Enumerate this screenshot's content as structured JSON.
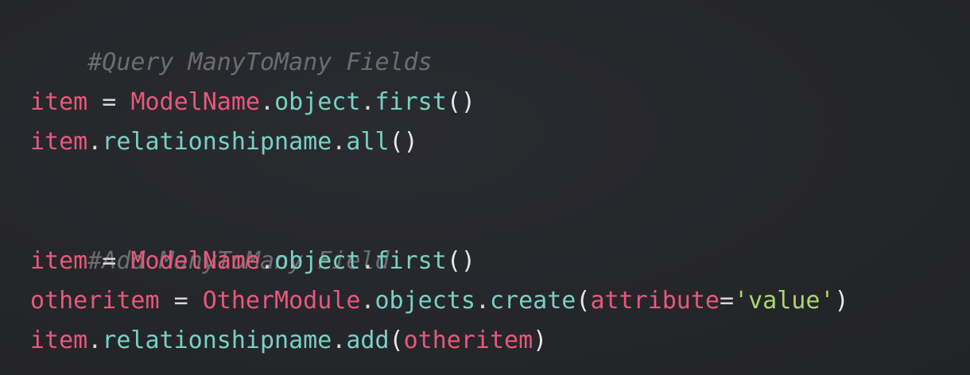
{
  "code": {
    "comment_1": "#Query ManyToMany Fields",
    "l1": {
      "a": "item",
      "eq": " = ",
      "b": "ModelName",
      "d1": ".",
      "c": "object",
      "d2": ".",
      "m": "first",
      "p": "()"
    },
    "l2": {
      "a": "item",
      "d1": ".",
      "b": "relationshipname",
      "d2": ".",
      "m": "all",
      "p": "()"
    },
    "comment_2": "#Add ManyToMany Field",
    "l3": {
      "a": "item",
      "eq": " = ",
      "b": "ModelName",
      "d1": ".",
      "c": "object",
      "d2": ".",
      "m": "first",
      "p": "()"
    },
    "l4": {
      "a": "otheritem",
      "eq": " = ",
      "b": "OtherModule",
      "d1": ".",
      "c": "objects",
      "d2": ".",
      "m": "create",
      "po": "(",
      "arg": "attribute",
      "aeq": "=",
      "val": "'value'",
      "pc": ")"
    },
    "l5": {
      "a": "item",
      "d1": ".",
      "b": "relationshipname",
      "d2": ".",
      "m": "add",
      "po": "(",
      "arg": "otheritem",
      "pc": ")"
    }
  },
  "colors": {
    "background": "#26272b",
    "comment": "#6c6d72",
    "identifier": "#e8587b",
    "method": "#78d1c4",
    "string": "#a9d86e",
    "punctuation": "#e8e8e8"
  }
}
